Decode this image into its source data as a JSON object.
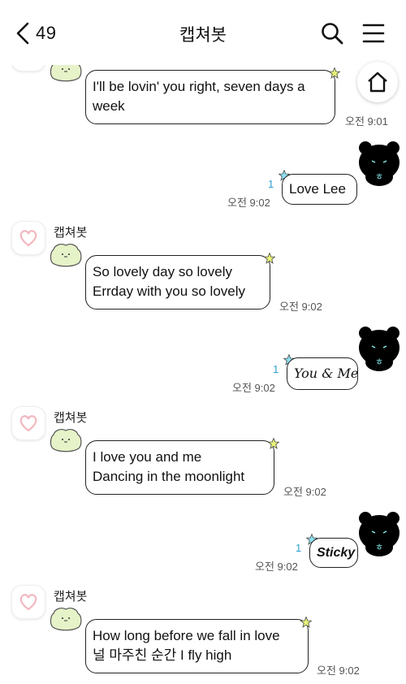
{
  "header": {
    "back_count": "49",
    "title": "캡쳐봇"
  },
  "colors": {
    "unread": "#2aa0d0",
    "bubble_border": "#222222",
    "star": "#e8f27a",
    "sticker_green": "#e6f2c8"
  },
  "icons": [
    "back-arrow-icon",
    "search-icon",
    "menu-icon",
    "home-icon"
  ],
  "messages": [
    {
      "type": "received",
      "text": "I'll be lovin' you right, seven days a\nweek",
      "time": "오전 9:01"
    },
    {
      "type": "sent",
      "text": "Love Lee",
      "time": "오전 9:02",
      "unread": "1"
    },
    {
      "type": "received",
      "sender": "캡쳐봇",
      "text": "So lovely day so lovely\nErrday with you so lovely",
      "time": "오전 9:02"
    },
    {
      "type": "sent",
      "text": "You & Me",
      "time": "오전 9:02",
      "unread": "1"
    },
    {
      "type": "received",
      "sender": "캡쳐봇",
      "text": "I love you and me\nDancing in the moonlight",
      "time": "오전 9:02"
    },
    {
      "type": "sent",
      "text": "Sticky",
      "time": "오전 9:02",
      "unread": "1"
    },
    {
      "type": "received",
      "sender": "캡쳐봇",
      "text": "How long before we fall in love\n널 마주친 순간 I fly high",
      "time": "오전 9:02"
    }
  ]
}
